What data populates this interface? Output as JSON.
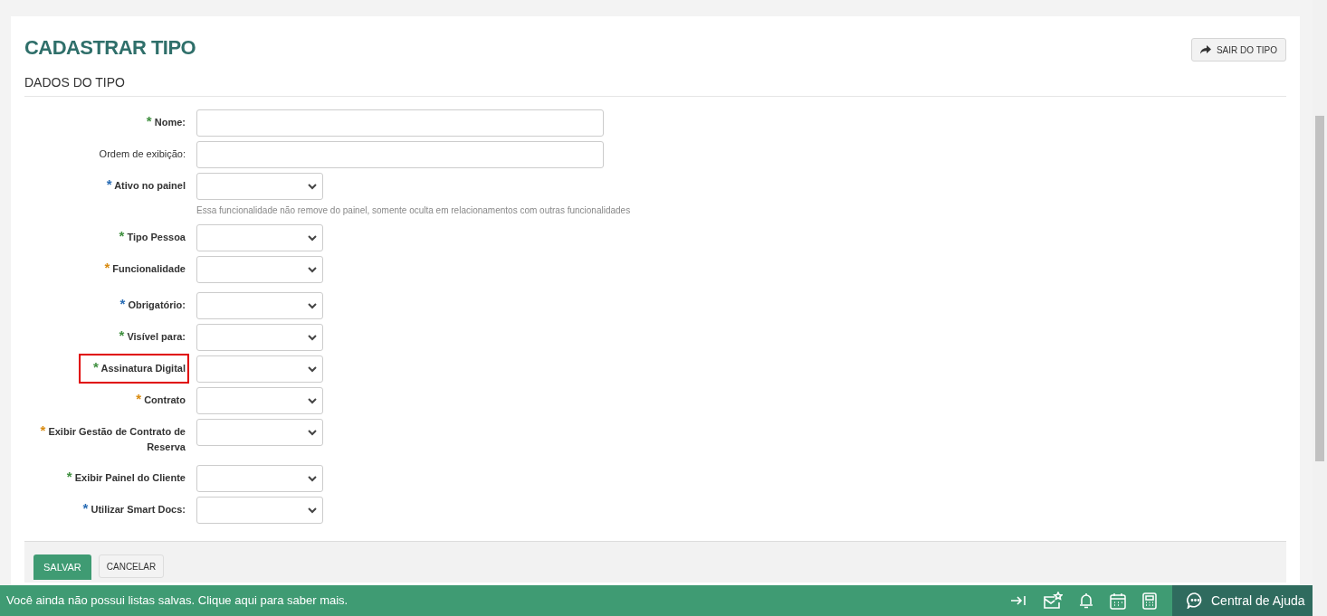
{
  "page": {
    "title": "CADASTRAR TIPO",
    "exit_button": "SAIR DO TIPO"
  },
  "section": {
    "title": "DADOS DO TIPO"
  },
  "fields": [
    {
      "kind": "text",
      "marker": "*",
      "label": "Nome:",
      "color": "#3f8f3f",
      "bold": true,
      "highlighted": false
    },
    {
      "kind": "text",
      "label": "Ordem de exibição:",
      "bold": false,
      "highlighted": false
    },
    {
      "kind": "select",
      "marker": "*",
      "label": "Ativo no painel",
      "color": "#2a6db5",
      "bold": true,
      "highlighted": false,
      "hint": "Essa funcionalidade não remove do painel, somente oculta em relacionamentos com outras funcionalidades"
    },
    {
      "kind": "select",
      "marker": "*",
      "label": "Tipo Pessoa",
      "color": "#3f8f3f",
      "bold": true,
      "highlighted": false
    },
    {
      "kind": "select",
      "marker": "*",
      "label": "Funcionalidade",
      "color": "#d98b10",
      "bold": true,
      "highlighted": false
    },
    {
      "kind": "select",
      "marker": "*",
      "label": "Obrigatório:",
      "color": "#2a6db5",
      "bold": true,
      "highlighted": false
    },
    {
      "kind": "select",
      "marker": "*",
      "label": "Visível para:",
      "color": "#3f8f3f",
      "bold": true,
      "highlighted": false
    },
    {
      "kind": "select",
      "marker": "*",
      "label": "Assinatura Digital",
      "color": "#3f8f3f",
      "bold": true,
      "highlighted": true
    },
    {
      "kind": "select",
      "marker": "*",
      "label": "Contrato",
      "color": "#d98b10",
      "bold": true,
      "highlighted": false
    },
    {
      "kind": "select",
      "marker": "*",
      "label": "Exibir Gestão de Contrato de Reserva",
      "color": "#d98b10",
      "bold": true,
      "highlighted": false
    },
    {
      "kind": "select",
      "marker": "*",
      "label": "Exibir Painel do Cliente",
      "color": "#3f8f3f",
      "bold": true,
      "highlighted": false
    },
    {
      "kind": "select",
      "marker": "*",
      "label": "Utilizar Smart Docs:",
      "color": "#2a6db5",
      "bold": true,
      "highlighted": false
    }
  ],
  "actions": {
    "save": "SALVAR",
    "cancel": "CANCELAR"
  },
  "bottom_bar": {
    "message": "Você ainda não possui listas salvas. Clique aqui para saber mais.",
    "help": "Central de Ajuda"
  }
}
